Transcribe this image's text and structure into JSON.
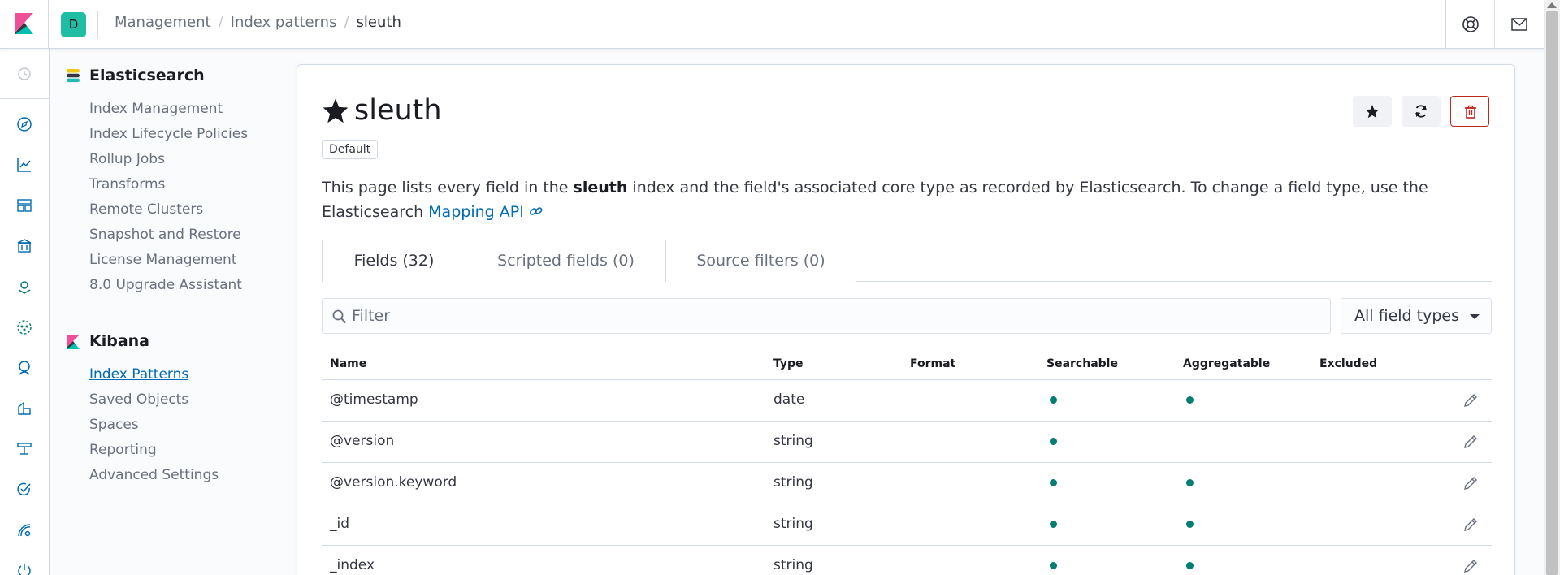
{
  "header": {
    "space_initial": "D",
    "breadcrumbs": [
      "Management",
      "Index patterns",
      "sleuth"
    ],
    "separator": "/"
  },
  "sidenav": {
    "elasticsearch": {
      "title": "Elasticsearch",
      "items": [
        "Index Management",
        "Index Lifecycle Policies",
        "Rollup Jobs",
        "Transforms",
        "Remote Clusters",
        "Snapshot and Restore",
        "License Management",
        "8.0 Upgrade Assistant"
      ]
    },
    "kibana": {
      "title": "Kibana",
      "items": [
        "Index Patterns",
        "Saved Objects",
        "Spaces",
        "Reporting",
        "Advanced Settings"
      ],
      "active_index": 0
    }
  },
  "page": {
    "title": "sleuth",
    "badge": "Default",
    "description_prefix": "This page lists every field in the ",
    "description_bold": "sleuth",
    "description_middle": " index and the field's associated core type as recorded by Elasticsearch. To change a field type, use the Elasticsearch ",
    "description_link": "Mapping API"
  },
  "tabs": [
    {
      "label": "Fields (32)",
      "selected": true
    },
    {
      "label": "Scripted fields (0)",
      "selected": false
    },
    {
      "label": "Source filters (0)",
      "selected": false
    }
  ],
  "filter": {
    "placeholder": "Filter",
    "type_select": "All field types"
  },
  "table": {
    "columns": [
      "Name",
      "Type",
      "Format",
      "Searchable",
      "Aggregatable",
      "Excluded"
    ],
    "rows": [
      {
        "name": "@timestamp",
        "type": "date",
        "format": "",
        "searchable": true,
        "aggregatable": true,
        "excluded": false
      },
      {
        "name": "@version",
        "type": "string",
        "format": "",
        "searchable": true,
        "aggregatable": false,
        "excluded": false
      },
      {
        "name": "@version.keyword",
        "type": "string",
        "format": "",
        "searchable": true,
        "aggregatable": true,
        "excluded": false
      },
      {
        "name": "_id",
        "type": "string",
        "format": "",
        "searchable": true,
        "aggregatable": true,
        "excluded": false
      },
      {
        "name": "_index",
        "type": "string",
        "format": "",
        "searchable": true,
        "aggregatable": true,
        "excluded": false
      }
    ]
  },
  "colors": {
    "accent": "#006bb4",
    "avatar": "#20bda5",
    "dot": "#017d73",
    "danger": "#bd271e"
  },
  "icons": {
    "rail": [
      "compass-icon",
      "visualize-icon",
      "dashboard-icon",
      "canvas-icon",
      "maps-icon",
      "ml-icon",
      "siem-icon",
      "apm-icon",
      "infrastructure-icon",
      "uptime-icon",
      "monitoring-icon",
      "dev-tools-icon"
    ]
  }
}
